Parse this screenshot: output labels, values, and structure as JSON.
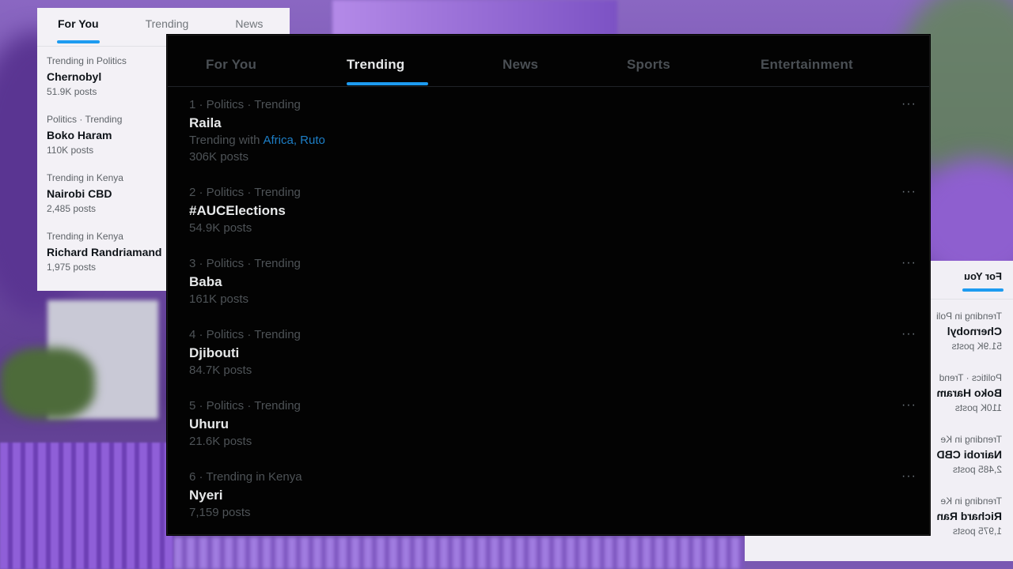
{
  "left_panel": {
    "tabs": [
      "For You",
      "Trending",
      "News"
    ],
    "trends": [
      {
        "meta": "Trending in Politics",
        "topic": "Chernobyl",
        "posts": "51.9K posts"
      },
      {
        "meta": "Politics · Trending",
        "topic": "Boko Haram",
        "posts": "110K posts"
      },
      {
        "meta": "Trending in Kenya",
        "topic": "Nairobi CBD",
        "posts": "2,485 posts"
      },
      {
        "meta": "Trending in Kenya",
        "topic": "Richard Randriamand",
        "posts": "1,975 posts"
      }
    ]
  },
  "right_panel": {
    "tab": "For You",
    "trends": [
      {
        "meta": "Trending in Poli",
        "topic": "Chernobyl",
        "posts": "51.9K posts"
      },
      {
        "meta": "Politics · Trend",
        "topic": "Boko Haram",
        "posts": "110K posts"
      },
      {
        "meta": "Trending in Ke",
        "topic": "Nairobi CBD",
        "posts": "2,485 posts"
      },
      {
        "meta": "Trending in Ke",
        "topic": "Richard Ran",
        "posts": "1,975 posts"
      }
    ]
  },
  "main_panel": {
    "tabs": [
      "For You",
      "Trending",
      "News",
      "Sports",
      "Entertainment"
    ],
    "active_tab": "Trending",
    "more_label": "···",
    "trends": [
      {
        "meta": "1 · Politics · Trending",
        "topic": "Raila",
        "with_label": "Trending with",
        "with_links": "Africa, Ruto",
        "posts": "306K posts"
      },
      {
        "meta": "2 · Politics · Trending",
        "topic": "#AUCElections",
        "posts": "54.9K posts"
      },
      {
        "meta": "3 · Politics · Trending",
        "topic": "Baba",
        "posts": "161K posts"
      },
      {
        "meta": "4 · Politics · Trending",
        "topic": "Djibouti",
        "posts": "84.7K posts"
      },
      {
        "meta": "5 · Politics · Trending",
        "topic": "Uhuru",
        "posts": "21.6K posts"
      },
      {
        "meta": "6 · Trending in Kenya",
        "topic": "Nyeri",
        "posts": "7,159 posts"
      }
    ]
  },
  "colors": {
    "accent": "#1d9bf0",
    "link": "#1d7fc7",
    "dark_bg": "#030303",
    "light_bg": "#f3f1f6"
  }
}
